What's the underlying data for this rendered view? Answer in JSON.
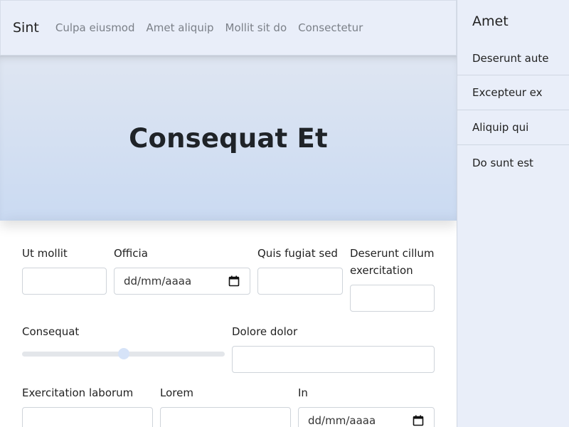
{
  "navbar": {
    "brand": "Sint",
    "links": [
      "Culpa eiusmod",
      "Amet aliquip",
      "Mollit sit do",
      "Consectetur"
    ]
  },
  "hero": {
    "title": "Consequat Et"
  },
  "form": {
    "row1": [
      {
        "label": "Ut mollit",
        "type": "text",
        "value": ""
      },
      {
        "label": "Officia",
        "type": "date",
        "placeholder": "dd/mm/aaaa"
      },
      {
        "label": "Quis fugiat sed",
        "type": "text",
        "value": ""
      },
      {
        "label": "Deserunt cillum exercitation",
        "type": "text",
        "value": ""
      }
    ],
    "row2": [
      {
        "label": "Consequat",
        "type": "range",
        "value_fraction": 0.5
      },
      {
        "label": "Dolore dolor",
        "type": "text",
        "value": ""
      }
    ],
    "row3": [
      {
        "label": "Exercitation laborum",
        "type": "text",
        "value": ""
      },
      {
        "label": "Lorem",
        "type": "text",
        "value": ""
      },
      {
        "label": "In",
        "type": "date",
        "placeholder": "dd/mm/aaaa"
      }
    ]
  },
  "sidebar": {
    "title": "Amet",
    "items": [
      "Deserunt aute",
      "Excepteur ex",
      "Aliquip qui",
      "Do sunt est"
    ]
  },
  "colors": {
    "nav_bg": "#e9eef9",
    "hero_top": "#dfe6f2",
    "hero_bottom": "#cadaf2",
    "sidebar_bg": "#e9eef9",
    "range_thumb": "#d6e3f8"
  },
  "icons": {
    "date_picker": "calendar-icon"
  }
}
